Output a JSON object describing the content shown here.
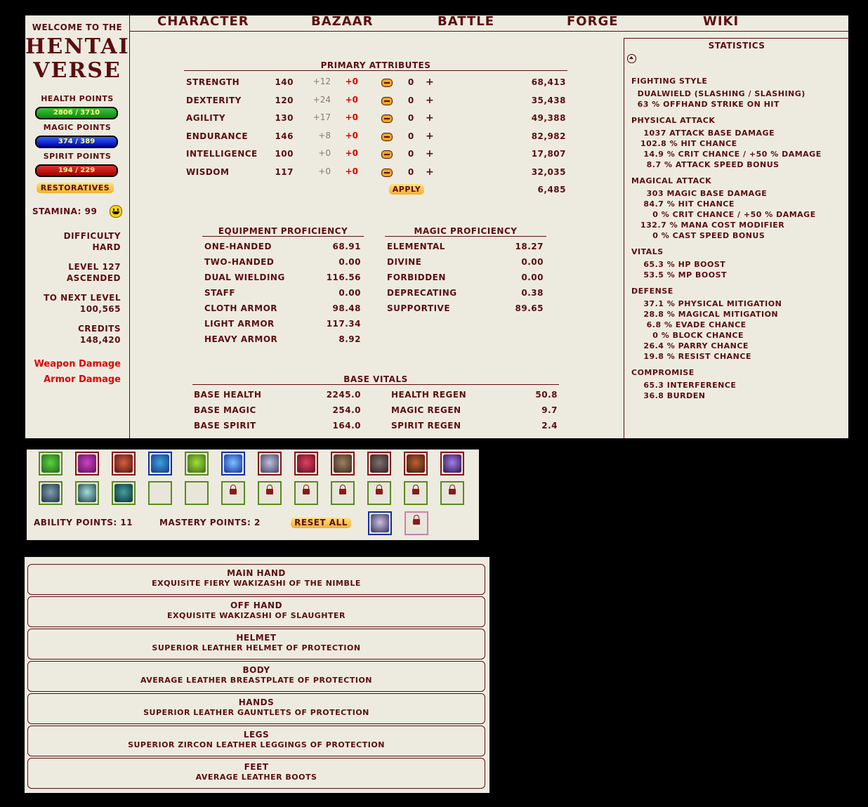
{
  "brand": {
    "welcome": "Welcome to the",
    "logo_line1": "HENTAI",
    "logo_line2": "VERSE"
  },
  "nav": [
    "Character",
    "Bazaar",
    "Battle",
    "Forge",
    "Wiki"
  ],
  "vitals_bars": {
    "health_label": "Health Points",
    "health_value": "2806 / 3710",
    "magic_label": "Magic Points",
    "magic_value": "374 / 389",
    "spirit_label": "Spirit Points",
    "spirit_value": "194 / 229"
  },
  "restoratives": "Restoratives",
  "stamina": "Stamina: 99",
  "difficulty": {
    "label": "Difficulty",
    "value": "Hard"
  },
  "level": {
    "label": "Level 127",
    "value": "Ascended"
  },
  "next_level": {
    "label": "To Next Level",
    "value": "100,565"
  },
  "credits": {
    "label": "Credits",
    "value": "148,420"
  },
  "damage_links": {
    "weapon": "Weapon Damage",
    "armor": "Armor Damage"
  },
  "primary": {
    "title": "Primary Attributes",
    "rows": [
      {
        "name": "Strength",
        "base": "140",
        "bonus": "+12",
        "mod": "+0",
        "alloc": "0",
        "exp": "68,413"
      },
      {
        "name": "Dexterity",
        "base": "120",
        "bonus": "+24",
        "mod": "+0",
        "alloc": "0",
        "exp": "35,438"
      },
      {
        "name": "Agility",
        "base": "130",
        "bonus": "+17",
        "mod": "+0",
        "alloc": "0",
        "exp": "49,388"
      },
      {
        "name": "Endurance",
        "base": "146",
        "bonus": "+8",
        "mod": "+0",
        "alloc": "0",
        "exp": "82,982"
      },
      {
        "name": "Intelligence",
        "base": "100",
        "bonus": "+0",
        "mod": "+0",
        "alloc": "0",
        "exp": "17,807"
      },
      {
        "name": "Wisdom",
        "base": "117",
        "bonus": "+0",
        "mod": "+0",
        "alloc": "0",
        "exp": "32,035"
      }
    ],
    "apply": "Apply",
    "remaining": "6,485"
  },
  "equipment_prof": {
    "title": "Equipment Proficiency",
    "rows": [
      {
        "name": "One-handed",
        "value": "68.91"
      },
      {
        "name": "Two-handed",
        "value": "0.00"
      },
      {
        "name": "Dual Wielding",
        "value": "116.56"
      },
      {
        "name": "Staff",
        "value": "0.00"
      },
      {
        "name": "Cloth Armor",
        "value": "98.48"
      },
      {
        "name": "Light Armor",
        "value": "117.34"
      },
      {
        "name": "Heavy Armor",
        "value": "8.92"
      }
    ]
  },
  "magic_prof": {
    "title": "Magic Proficiency",
    "rows": [
      {
        "name": "Elemental",
        "value": "18.27"
      },
      {
        "name": "Divine",
        "value": "0.00"
      },
      {
        "name": "Forbidden",
        "value": "0.00"
      },
      {
        "name": "Deprecating",
        "value": "0.38"
      },
      {
        "name": "Supportive",
        "value": "89.65"
      }
    ]
  },
  "base_vitals": {
    "title": "Base Vitals",
    "left": [
      {
        "name": "Base Health",
        "value": "2245.0"
      },
      {
        "name": "Base Magic",
        "value": "254.0"
      },
      {
        "name": "Base Spirit",
        "value": "164.0"
      }
    ],
    "right": [
      {
        "name": "Health Regen",
        "value": "50.8"
      },
      {
        "name": "Magic Regen",
        "value": "9.7"
      },
      {
        "name": "Spirit Regen",
        "value": "2.4"
      }
    ]
  },
  "statistics": {
    "title": "Statistics",
    "lines": [
      {
        "text": "Fighting Style",
        "head": true
      },
      {
        "text": "  Dualwield (Slashing / Slashing)"
      },
      {
        "text": "  63 % offhand strike on hit"
      },
      {
        "text": "Physical Attack",
        "head": true
      },
      {
        "text": "    1037 attack base damage"
      },
      {
        "text": "   102.8 % hit chance"
      },
      {
        "text": "    14.9 % crit chance / +50 % damage"
      },
      {
        "text": "     8.7 % attack speed bonus"
      },
      {
        "text": "Magical Attack",
        "head": true
      },
      {
        "text": "     303 magic base damage"
      },
      {
        "text": "    84.7 % hit chance"
      },
      {
        "text": "       0 % crit chance / +50 % damage"
      },
      {
        "text": "   132.7 % mana cost modifier"
      },
      {
        "text": "       0 % cast speed bonus"
      },
      {
        "text": "Vitals",
        "head": true
      },
      {
        "text": "    65.3 % HP boost"
      },
      {
        "text": "    53.5 % MP boost"
      },
      {
        "text": "Defense",
        "head": true
      },
      {
        "text": "    37.1 % physical mitigation"
      },
      {
        "text": "    28.8 % magical mitigation"
      },
      {
        "text": "     6.8 % evade chance"
      },
      {
        "text": "       0 % block chance"
      },
      {
        "text": "    26.4 % parry chance"
      },
      {
        "text": "    19.8 % resist chance"
      },
      {
        "text": "Compromise",
        "head": true
      },
      {
        "text": "    65.3 interference"
      },
      {
        "text": "    36.8 burden"
      }
    ]
  },
  "abilities": {
    "ability_points": "Ability Points: 11",
    "mastery_points": "Mastery Points: 2",
    "reset_all": "Reset All"
  },
  "equipment": [
    {
      "slot": "Main Hand",
      "item": "Exquisite Fiery Wakizashi of the Nimble"
    },
    {
      "slot": "Off Hand",
      "item": "Exquisite Wakizashi of Slaughter"
    },
    {
      "slot": "Helmet",
      "item": "Superior Leather Helmet of Protection"
    },
    {
      "slot": "Body",
      "item": "Average Leather Breastplate of Protection"
    },
    {
      "slot": "Hands",
      "item": "Superior Leather Gauntlets of Protection"
    },
    {
      "slot": "Legs",
      "item": "Superior Zircon Leather Leggings of Protection"
    },
    {
      "slot": "Feet",
      "item": "Average Leather Boots"
    }
  ]
}
